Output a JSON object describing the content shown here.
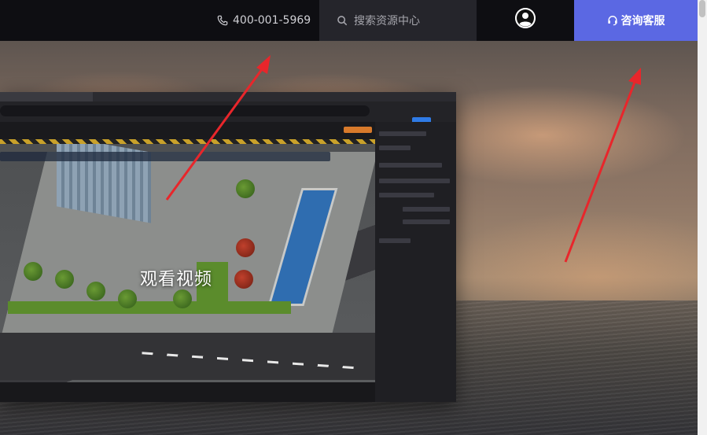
{
  "header": {
    "phone": "400-001-5969",
    "search_placeholder": "搜索资源中心",
    "consult_label": "咨询客服"
  },
  "video": {
    "label": "观看视频"
  },
  "icons": {
    "phone": "phone-icon",
    "search": "search-icon",
    "avatar": "user-avatar-icon",
    "headset": "headset-icon"
  },
  "colors": {
    "header_bg": "#0e0e12",
    "search_bg": "#25252b",
    "consult_bg": "#5b68e3",
    "arrow": "#e8262b"
  }
}
